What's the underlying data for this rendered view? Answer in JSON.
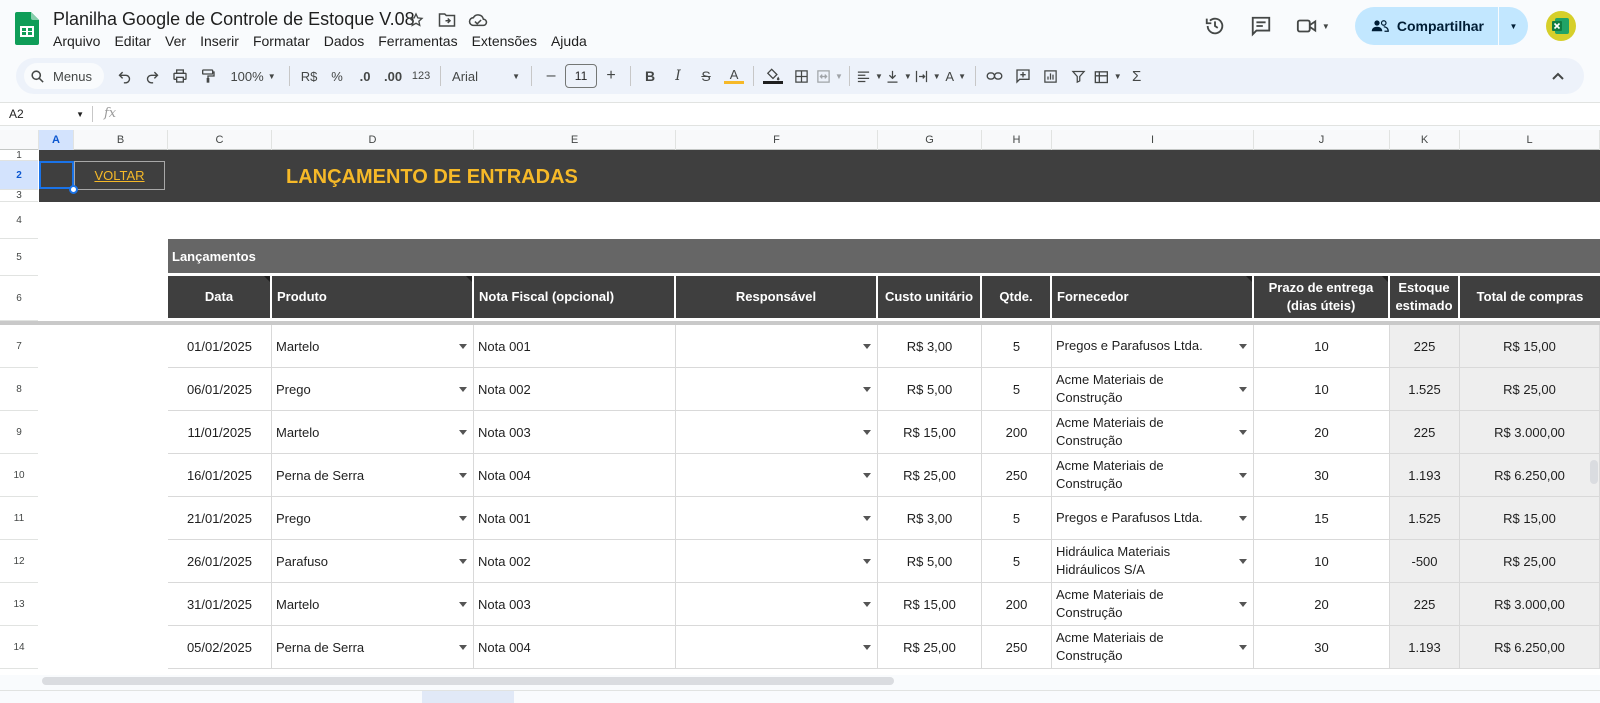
{
  "title": "Planilha Google de Controle de Estoque V.08",
  "menu": [
    "Arquivo",
    "Editar",
    "Ver",
    "Inserir",
    "Formatar",
    "Dados",
    "Ferramentas",
    "Extensões",
    "Ajuda"
  ],
  "share_label": "Compartilhar",
  "toolbar": {
    "search": "Menus",
    "zoom": "100%",
    "currency": "R$",
    "percent": "%",
    "dec_less": ".0",
    "dec_more": ".00",
    "number_format": "123",
    "font": "Arial",
    "font_size": "11"
  },
  "namebox": "A2",
  "fx": "fx",
  "columns": [
    "A",
    "B",
    "C",
    "D",
    "E",
    "F",
    "G",
    "H",
    "I",
    "J",
    "K",
    "L"
  ],
  "rows": [
    "1",
    "2",
    "3",
    "4",
    "5",
    "6",
    "7",
    "8",
    "9",
    "10",
    "11",
    "12",
    "13",
    "14"
  ],
  "sheet": {
    "voltar": "VOLTAR",
    "banner": "LANÇAMENTO DE ENTRADAS",
    "section": "Lançamentos",
    "headers": {
      "data": "Data",
      "produto": "Produto",
      "nota": "Nota Fiscal (opcional)",
      "responsavel": "Responsável",
      "custo": "Custo unitário",
      "qtde": "Qtde.",
      "fornecedor": "Fornecedor",
      "prazo_1": "Prazo de entrega",
      "prazo_2": "(dias úteis)",
      "estoque_1": "Estoque",
      "estoque_2": "estimado",
      "total": "Total de compras"
    },
    "data_rows": [
      {
        "data": "01/01/2025",
        "produto": "Martelo",
        "nota": "Nota 001",
        "responsavel": "",
        "custo": "R$ 3,00",
        "qtde": "5",
        "fornecedor": "Pregos e Parafusos Ltda.",
        "prazo": "10",
        "estoque": "225",
        "total": "R$ 15,00"
      },
      {
        "data": "06/01/2025",
        "produto": "Prego",
        "nota": "Nota 002",
        "responsavel": "",
        "custo": "R$ 5,00",
        "qtde": "5",
        "fornecedor": "Acme Materiais de Construção",
        "prazo": "10",
        "estoque": "1.525",
        "total": "R$ 25,00"
      },
      {
        "data": "11/01/2025",
        "produto": "Martelo",
        "nota": "Nota 003",
        "responsavel": "",
        "custo": "R$ 15,00",
        "qtde": "200",
        "fornecedor": "Acme Materiais de Construção",
        "prazo": "20",
        "estoque": "225",
        "total": "R$ 3.000,00"
      },
      {
        "data": "16/01/2025",
        "produto": "Perna de Serra",
        "nota": "Nota 004",
        "responsavel": "",
        "custo": "R$ 25,00",
        "qtde": "250",
        "fornecedor": "Acme Materiais de Construção",
        "prazo": "30",
        "estoque": "1.193",
        "total": "R$ 6.250,00"
      },
      {
        "data": "21/01/2025",
        "produto": "Prego",
        "nota": "Nota 001",
        "responsavel": "",
        "custo": "R$ 3,00",
        "qtde": "5",
        "fornecedor": "Pregos e Parafusos Ltda.",
        "prazo": "15",
        "estoque": "1.525",
        "total": "R$ 15,00"
      },
      {
        "data": "26/01/2025",
        "produto": "Parafuso",
        "nota": "Nota 002",
        "responsavel": "",
        "custo": "R$ 5,00",
        "qtde": "5",
        "fornecedor": "Hidráulica Materiais Hidráulicos S/A",
        "prazo": "10",
        "estoque": "-500",
        "total": "R$ 25,00"
      },
      {
        "data": "31/01/2025",
        "produto": "Martelo",
        "nota": "Nota 003",
        "responsavel": "",
        "custo": "R$ 15,00",
        "qtde": "200",
        "fornecedor": "Acme Materiais de Construção",
        "prazo": "20",
        "estoque": "225",
        "total": "R$ 3.000,00"
      },
      {
        "data": "05/02/2025",
        "produto": "Perna de Serra",
        "nota": "Nota 004",
        "responsavel": "",
        "custo": "R$ 25,00",
        "qtde": "250",
        "fornecedor": "Acme Materiais de Construção",
        "prazo": "30",
        "estoque": "1.193",
        "total": "R$ 6.250,00"
      }
    ]
  },
  "colors": {
    "banner": "#3f3f3f",
    "accent": "#f6b928",
    "section": "#666666",
    "share": "#c2e7ff",
    "selection": "#1a73e8"
  }
}
